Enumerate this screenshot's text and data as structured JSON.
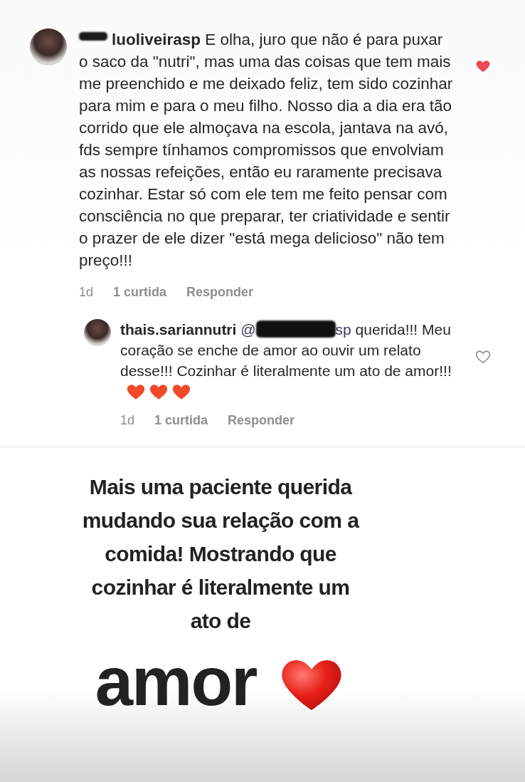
{
  "comments": [
    {
      "username": "luoliveirasp",
      "username_redacted": true,
      "text": "E olha, juro que não é para puxar o saco da \"nutri\", mas uma das coisas que tem mais me preenchido e me deixado feliz, tem sido cozinhar para mim e para o meu filho. Nosso dia a dia era tão corrido que ele almoçava na escola, jantava na avó, fds sempre tínhamos compromissos que envolviam as nossas refeições, então eu raramente precisava cozinhar. Estar só com ele tem me feito pensar com consciência no que preparar, ter criatividade e sentir o prazer de ele dizer \"está mega delicioso\" não tem preço!!!",
      "time": "1d",
      "likes": "1 curtida",
      "reply_label": "Responder",
      "liked": true,
      "replies": [
        {
          "username": "thais.sariannutri",
          "mention_start": "@",
          "mention_end": "sp",
          "text": "querida!!! Meu coração se enche de amor ao ouvir um relato desse!!! Cozinhar é literalmente um ato de amor!!!",
          "emojis": [
            {
              "kind": "heart"
            },
            {
              "kind": "heart"
            },
            {
              "kind": "heart"
            }
          ],
          "time": "1d",
          "likes": "1 curtida",
          "reply_label": "Responder",
          "liked": false
        }
      ]
    }
  ],
  "caption": {
    "text": "Mais uma paciente querida mudando sua relação com a comida! Mostrando que cozinhar é literalmente um ato de",
    "big_word": "amor"
  }
}
